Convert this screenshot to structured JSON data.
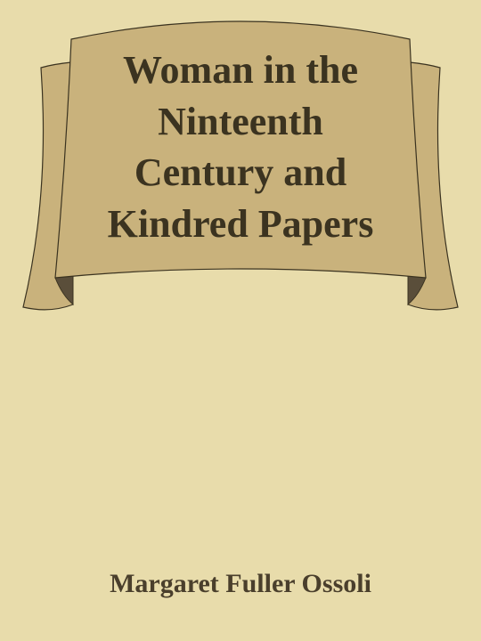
{
  "book": {
    "title_lines": [
      "Woman in the",
      "Ninteenth",
      "Century and",
      "Kindred Papers"
    ],
    "author": "Margaret Fuller Ossoli"
  },
  "colors": {
    "background": "#e8dcab",
    "banner_fill": "#c9b27c",
    "banner_shadow": "#5a4e3a",
    "banner_outline": "#3b3320",
    "title_text": "#3b3320",
    "author_text": "#4a3f2c"
  },
  "decoration": {
    "banner": "ribbon-scroll"
  }
}
